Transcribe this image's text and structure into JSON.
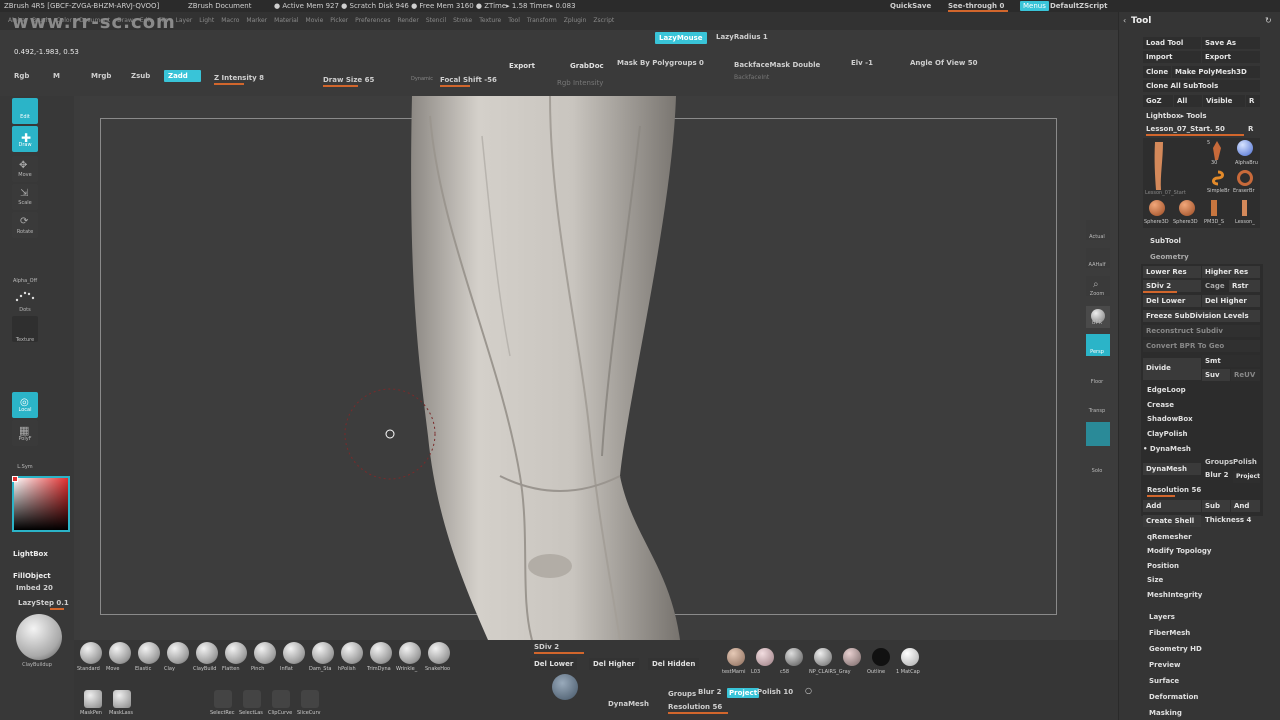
{
  "titlebar": {
    "app": "ZBrush 4R5 [GBCF-ZVGA-BHZM-ARVJ-QVOO]",
    "doc": "ZBrush Document",
    "stats": "● Active Mem 927  ● Scratch Disk 946  ● Free Mem 3160  ● ZTime▸ 1.58  Timer▸ 0.083",
    "quicksave": "QuickSave",
    "seethrough": "See-through  0",
    "menus": "Menus",
    "defaultscript": "DefaultZScript"
  },
  "menubar": [
    "Alpha",
    "Brush",
    "Color",
    "Document",
    "Draw",
    "Edit",
    "File",
    "Layer",
    "Light",
    "Macro",
    "Marker",
    "Material",
    "Movie",
    "Picker",
    "Preferences",
    "Render",
    "Stencil",
    "Stroke",
    "Texture",
    "Tool",
    "Transform",
    "Zplugin",
    "Zscript"
  ],
  "coords": "0.492,-1.983, 0.53",
  "top_controls": {
    "lazymouse": "LazyMouse",
    "lazyradius": "LazyRadius 1",
    "export": "Export",
    "grabdoc": "GrabDoc",
    "mask_by_polygroups": "Mask By Polygroups 0",
    "backface": "BackfaceMask  Double",
    "backfaceint": "BackfaceInt",
    "elv": "Elv -1",
    "angle_of_view": "Angle Of View 50"
  },
  "draw_controls": {
    "rgb": "Rgb",
    "m": "M",
    "mrgb": "Mrgb",
    "zsub": "Zsub",
    "zadd": "Zadd",
    "z_intensity": "Z Intensity 8",
    "draw_size": "Draw Size 65",
    "dynamic": "Dynamic",
    "focal_shift": "Focal Shift -56",
    "rgb_intensity": "Rgb Intensity"
  },
  "left_shelf": {
    "edit": "Edit",
    "draw": "Draw",
    "move": "Move",
    "scale": "Scale",
    "rotate": "Rotate",
    "alpha": "Alpha_Off",
    "dots": "Dots",
    "texture": "Texture",
    "local": "Local",
    "polyf": "PolyF",
    "sym": "L.Sym",
    "lightbox": "LightBox",
    "fillobject": "FillObject",
    "imbed": "Imbed 20",
    "lazystep": "LazyStep 0.1",
    "claybuildup": "ClayBuildup"
  },
  "right_shelf": [
    "Actual",
    "AAHalf",
    "Zoom",
    "BPR",
    "Persp",
    "Floor",
    "Transp",
    "Solo"
  ],
  "tool_panel": {
    "header": "Tool",
    "load_tool": "Load Tool",
    "save_as": "Save As",
    "import": "Import",
    "export": "Export",
    "clone": "Clone",
    "make_polymesh": "Make PolyMesh3D",
    "clone_all": "Clone All SubTools",
    "goz": "GoZ",
    "all": "All",
    "visible": "Visible",
    "r": "R",
    "lightbox_tools": "Lightbox▸ Tools",
    "lesson": "Lesson_07_Start. 50",
    "thumbs": [
      {
        "label": "Lesson_07_Start"
      },
      {
        "label": "SimpleBr"
      },
      {
        "label": "AlphaBru"
      },
      {
        "label": "EraserBr"
      },
      {
        "label": "Sphere3D"
      },
      {
        "label": "Sphere3D"
      },
      {
        "label": "PM3D_S"
      },
      {
        "label": "Lesson_"
      }
    ],
    "thumb_count": "5",
    "thumb_30": "30",
    "subtool": "SubTool",
    "geometry": "Geometry",
    "lower_res": "Lower Res",
    "higher_res": "Higher Res",
    "sdiv": "SDiv 2",
    "cage": "Cage",
    "rstr": "Rstr",
    "del_lower": "Del Lower",
    "del_higher": "Del Higher",
    "freeze": "Freeze SubDivision Levels",
    "reconstruct": "Reconstruct Subdiv",
    "convert_bpr": "Convert BPR To Geo",
    "divide": "Divide",
    "smt": "Smt",
    "suv": "Suv",
    "reuv": "ReUV",
    "edgeloop": "EdgeLoop",
    "crease": "Crease",
    "shadowbox": "ShadowBox",
    "claypolish": "ClayPolish",
    "dynamesh_h": "DynaMesh",
    "dynamesh": "DynaMesh",
    "groups": "Groups",
    "polish": "Polish",
    "blur": "Blur 2",
    "project": "Project",
    "resolution": "Resolution 56",
    "add": "Add",
    "sub": "Sub",
    "and": "And",
    "create_shell": "Create Shell",
    "thickness": "Thickness 4",
    "qremesher": "qRemesher",
    "modify_topology": "Modify Topology",
    "position": "Position",
    "size": "Size",
    "meshintegrity": "MeshIntegrity",
    "layers": "Layers",
    "fibermesh": "FiberMesh",
    "geometry_hd": "Geometry HD",
    "preview": "Preview",
    "surface": "Surface",
    "deformation": "Deformation",
    "masking": "Masking"
  },
  "bottom": {
    "brushes": [
      "Standard",
      "Move",
      "Elastic",
      "Clay",
      "ClayBuild",
      "Flatten",
      "Pinch",
      "Inflat",
      "Dam_Sta",
      "hPolish",
      "TrimDyna",
      "Wrinkle_",
      "SnakeHoo"
    ],
    "tools2": [
      "MaskPen",
      "MaskLass",
      "SelectRec",
      "SelectLas",
      "ClipCurve",
      "SliceCurv"
    ],
    "sdiv": "SDiv 2",
    "del_lower": "Del Lower",
    "del_higher": "Del Higher",
    "del_hidden": "Del Hidden",
    "groups": "Groups",
    "blur": "Blur 2",
    "project": "Project",
    "polish": "Polish 10",
    "dynamesh": "DynaMesh",
    "resolution": "Resolution 56",
    "materials": [
      "testMarni",
      "L03",
      "c58",
      "NP_CLAIRS_Gray",
      "",
      "Outline",
      "1 MatCap"
    ]
  },
  "watermark": "www.rr-sc.com"
}
